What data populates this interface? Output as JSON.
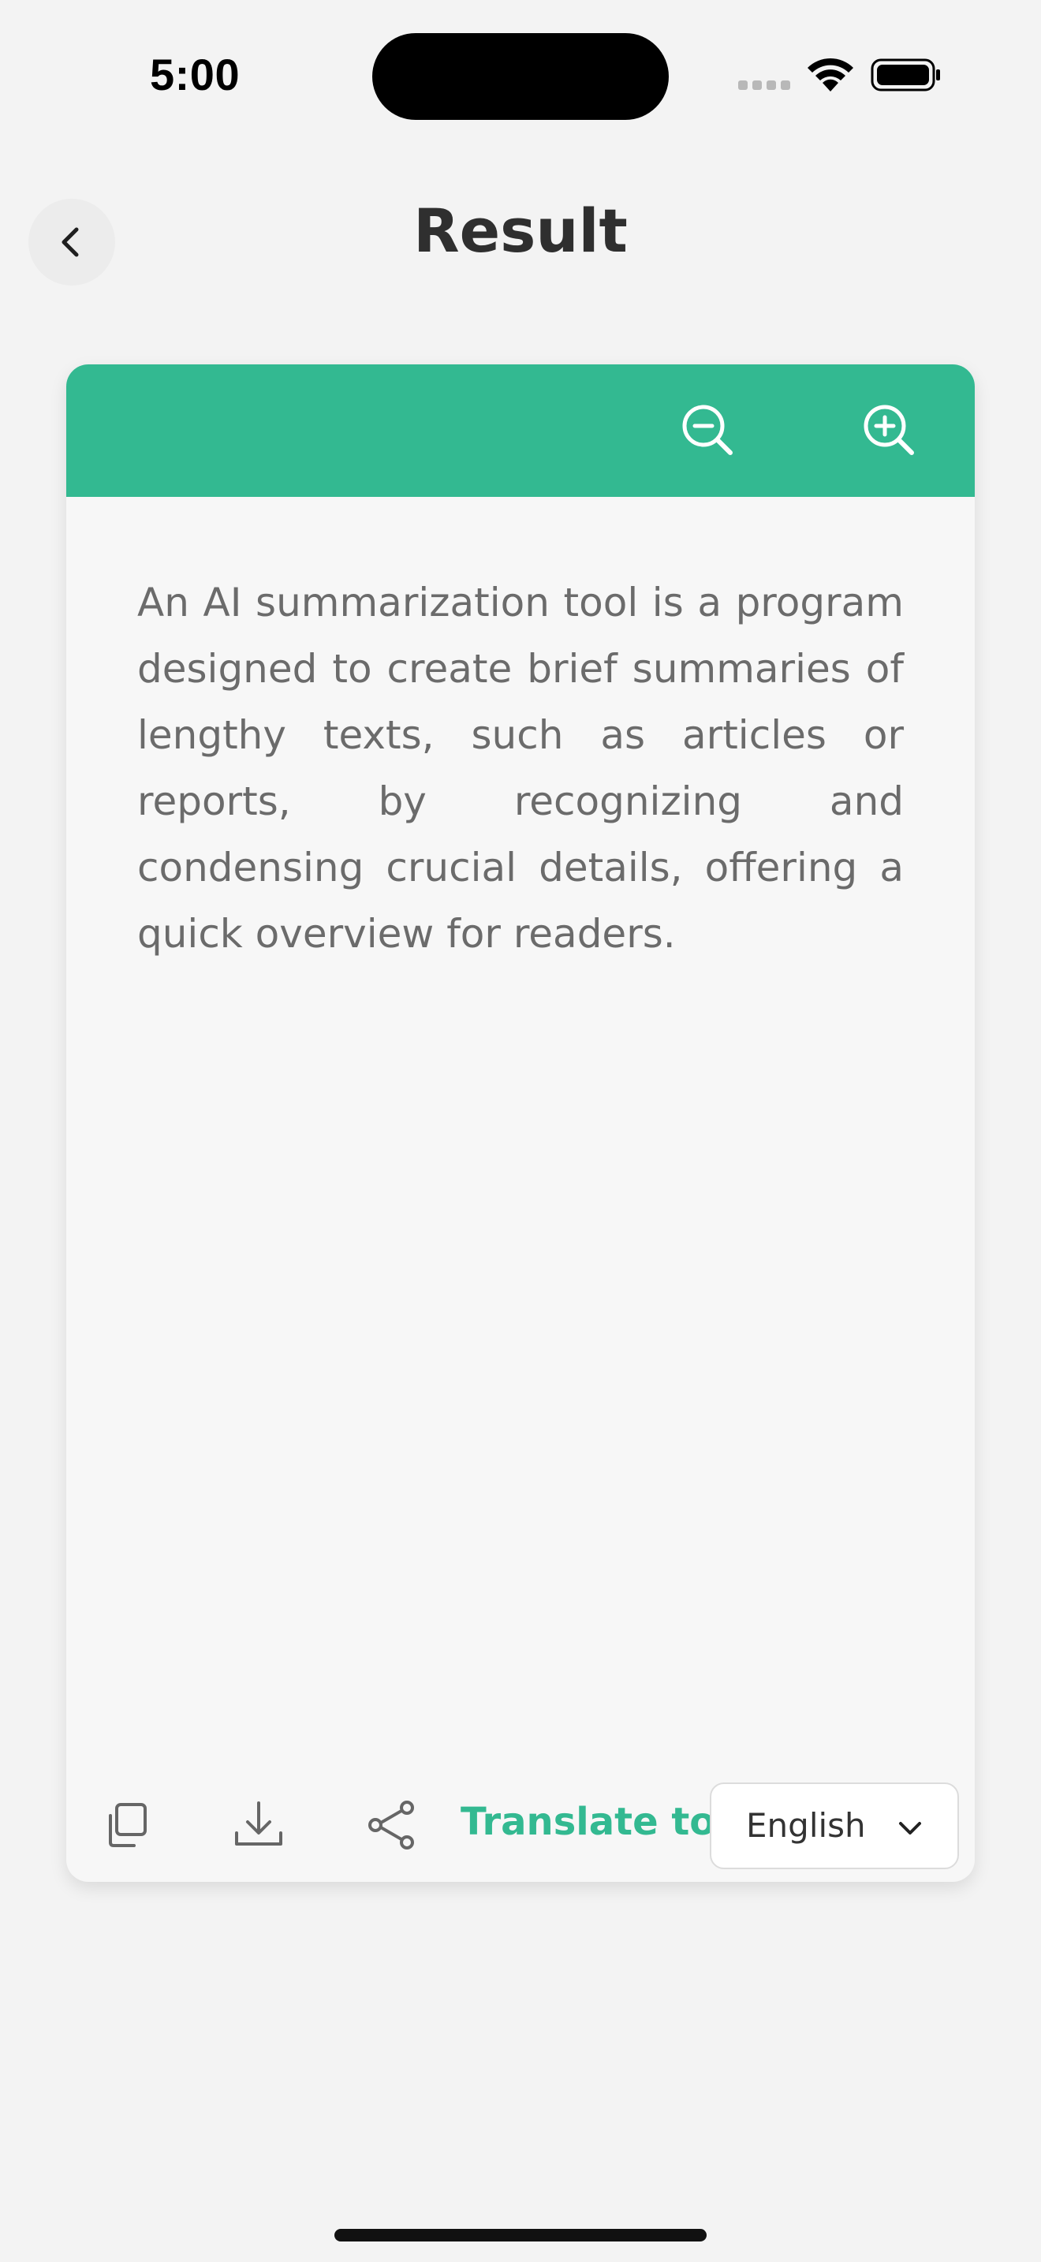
{
  "status_bar": {
    "time": "5:00"
  },
  "header": {
    "title": "Result",
    "back_icon": "chevron-left-icon"
  },
  "card": {
    "header_color": "#33b991",
    "zoom_out_icon": "zoom-out-icon",
    "zoom_in_icon": "zoom-in-icon",
    "summary_text": "An AI summarization tool is a program designed to create brief summaries of lengthy texts, such as articles or reports, by recognizing and condensing crucial details, offering a quick overview for readers."
  },
  "actions": {
    "copy_icon": "copy-icon",
    "download_icon": "download-icon",
    "share_icon": "share-icon",
    "translate_label": "Translate to",
    "language": "English"
  },
  "colors": {
    "accent": "#33b991",
    "background": "#f3f3f3",
    "card": "#f7f7f7"
  }
}
